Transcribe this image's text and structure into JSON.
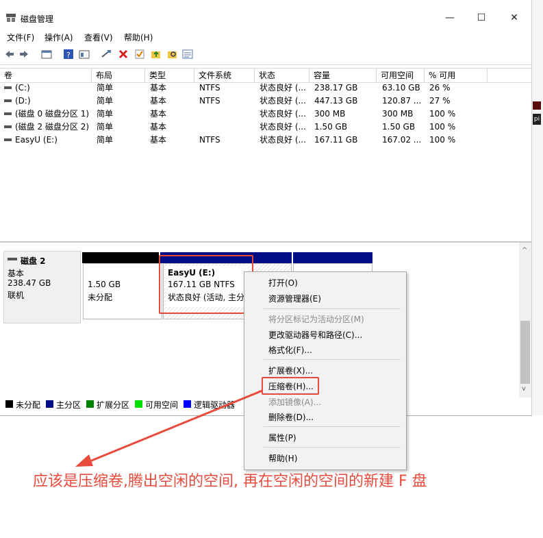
{
  "window": {
    "title": "磁盘管理",
    "controls": {
      "minimize": "—",
      "maximize": "☐",
      "close": "✕"
    }
  },
  "menubar": [
    "文件(F)",
    "操作(A)",
    "查看(V)",
    "帮助(H)"
  ],
  "toolbar": [
    "back-icon",
    "forward-icon",
    "console-icon",
    "help-icon",
    "properties-icon",
    "connect-icon",
    "delete-icon",
    "check-icon",
    "folder-up-icon",
    "search-folder-icon",
    "list-icon"
  ],
  "table": {
    "columns": [
      "卷",
      "布局",
      "类型",
      "文件系统",
      "状态",
      "容量",
      "可用空间",
      "% 可用"
    ],
    "rows": [
      [
        "(C:)",
        "简单",
        "基本",
        "NTFS",
        "状态良好 (...",
        "238.17 GB",
        "63.10 GB",
        "26 %"
      ],
      [
        "(D:)",
        "简单",
        "基本",
        "NTFS",
        "状态良好 (...",
        "447.13 GB",
        "120.87 ...",
        "27 %"
      ],
      [
        "(磁盘 0 磁盘分区 1)",
        "简单",
        "基本",
        "",
        "状态良好 (...",
        "300 MB",
        "300 MB",
        "100 %"
      ],
      [
        "(磁盘 2 磁盘分区 2)",
        "简单",
        "基本",
        "",
        "状态良好 (...",
        "1.50 GB",
        "1.50 GB",
        "100 %"
      ],
      [
        "EasyU (E:)",
        "简单",
        "基本",
        "NTFS",
        "状态良好 (...",
        "167.11 GB",
        "167.02 ...",
        "100 %"
      ]
    ]
  },
  "disk": {
    "name": "磁盘 2",
    "type": "基本",
    "size": "238.47 GB",
    "status": "联机",
    "partitions": {
      "unallocated": {
        "size": "1.50 GB",
        "label": "未分配"
      },
      "easyu": {
        "name": "EasyU  (E:)",
        "size": "167.11 GB NTFS",
        "status": "状态良好 (活动, 主分"
      }
    }
  },
  "legend": [
    {
      "label": "未分配",
      "color": "#000000"
    },
    {
      "label": "主分区",
      "color": "#000c84"
    },
    {
      "label": "扩展分区",
      "color": "#008000"
    },
    {
      "label": "可用空间",
      "color": "#00e000"
    },
    {
      "label": "逻辑驱动器",
      "color": "#0000ff"
    }
  ],
  "context_menu": {
    "open": "打开(O)",
    "explorer": "资源管理器(E)",
    "mark_active": "将分区标记为活动分区(M)",
    "change_letter": "更改驱动器号和路径(C)...",
    "format": "格式化(F)...",
    "extend": "扩展卷(X)...",
    "shrink": "压缩卷(H)...",
    "add_mirror": "添加镜像(A)...",
    "delete": "删除卷(D)...",
    "properties": "属性(P)",
    "help": "帮助(H)"
  },
  "annotation": {
    "caption": "应该是压缩卷,腾出空闲的空间, 再在空闲的空间的新建 F 盘",
    "color": "#e84b3c"
  },
  "background_strip": {
    "letters": "pi"
  }
}
